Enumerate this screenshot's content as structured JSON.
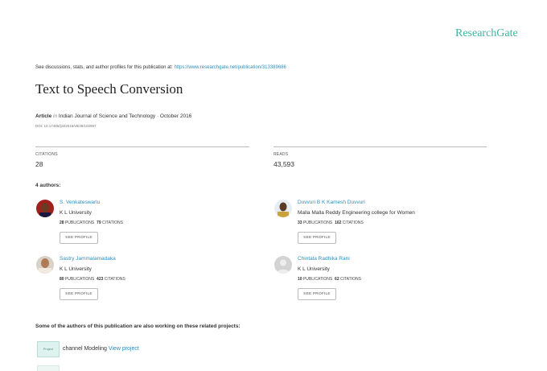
{
  "header": {
    "brand": "ResearchGate"
  },
  "discussion": {
    "text": "See discussions, stats, and author profiles for this publication at:",
    "url": "https://www.researchgate.net/publication/313389686"
  },
  "publication": {
    "title": "Text to Speech Conversion",
    "type": "Article",
    "in_word": "in",
    "journal": "Indian Journal of Science and Technology · October 2016",
    "doi": "DOI: 10.17485/ijst/2016/v9i38/102967"
  },
  "stats": {
    "citations_label": "CITATIONS",
    "citations_value": "28",
    "reads_label": "READS",
    "reads_value": "43,593"
  },
  "authors_heading": "4 authors:",
  "authors": [
    {
      "name": "S. Venkateswarlu",
      "affiliation": "K L University",
      "publications": "28",
      "publications_label": "PUBLICATIONS",
      "citations": "79",
      "citations_label": "CITATIONS",
      "button": "SEE PROFILE"
    },
    {
      "name": "Duvvuri B K Kamesh Duvvuri",
      "affiliation": "Malla Malla Reddy Engineering college for Women",
      "publications": "33",
      "publications_label": "PUBLICATIONS",
      "citations": "162",
      "citations_label": "CITATIONS",
      "button": "SEE PROFILE"
    },
    {
      "name": "Sastry Jammalamadaka",
      "affiliation": "K L University",
      "publications": "80",
      "publications_label": "PUBLICATIONS",
      "citations": "423",
      "citations_label": "CITATIONS",
      "button": "SEE PROFILE"
    },
    {
      "name": "Chintala Radhika Rani",
      "affiliation": "K L University",
      "publications": "10",
      "publications_label": "PUBLICATIONS",
      "citations": "62",
      "citations_label": "CITATIONS",
      "button": "SEE PROFILE"
    }
  ],
  "related": {
    "heading": "Some of the authors of this publication are also working on these related projects:",
    "projects": [
      {
        "icon_label": "Project",
        "name": "channel Modeling",
        "link": "View project"
      }
    ]
  }
}
